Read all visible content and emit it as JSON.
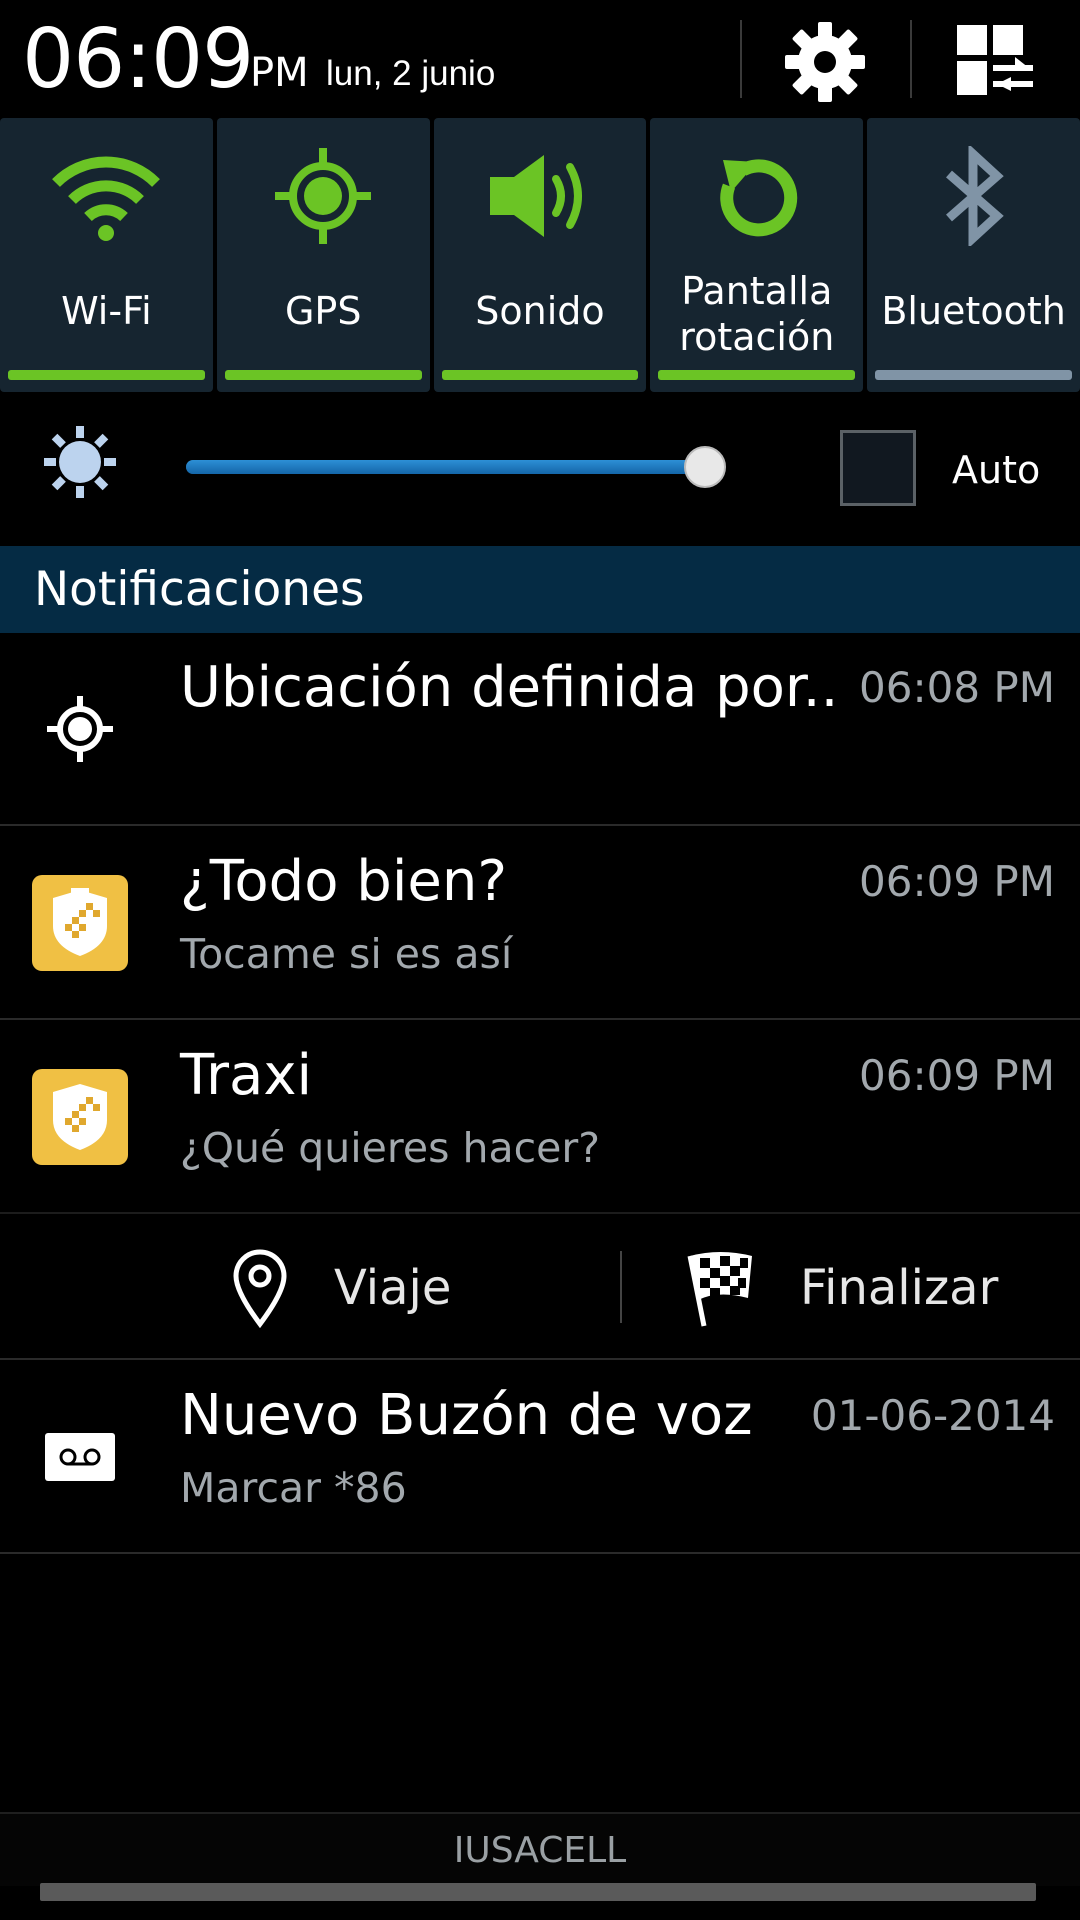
{
  "header": {
    "time": "06:09",
    "ampm": "PM",
    "date": "lun, 2 junio"
  },
  "toggles": [
    {
      "label": "Wi-Fi",
      "icon": "wifi-icon",
      "on": true
    },
    {
      "label": "GPS",
      "icon": "gps-icon",
      "on": true
    },
    {
      "label": "Sonido",
      "icon": "sound-icon",
      "on": true
    },
    {
      "label": "Pantalla rotación",
      "icon": "rotation-icon",
      "on": true
    },
    {
      "label": "Bluetooth",
      "icon": "bluetooth-icon",
      "on": false
    }
  ],
  "brightness": {
    "level": 0.965,
    "auto_label": "Auto",
    "auto_checked": false
  },
  "notifications_title": "Notificaciones",
  "notifications": [
    {
      "title": "Ubicación definida por..",
      "subtitle": "",
      "time": "06:08 PM",
      "icon": "location-target-icon"
    },
    {
      "title": "¿Todo bien?",
      "subtitle": "Tocame si es así",
      "time": "06:09 PM",
      "icon": "traxi-app-icon"
    },
    {
      "title": "Traxi",
      "subtitle": "¿Qué quieres hacer?",
      "time": "06:09 PM",
      "icon": "traxi-app-icon"
    },
    {
      "title": "Nuevo Buzón de voz",
      "subtitle": "Marcar *86",
      "time": "01-06-2014",
      "icon": "voicemail-icon"
    }
  ],
  "actions": [
    {
      "label": "Viaje",
      "icon": "map-pin-icon"
    },
    {
      "label": "Finalizar",
      "icon": "checkered-flag-icon"
    }
  ],
  "carrier": "IUSACELL",
  "colors": {
    "toggle_on": "#6bc425",
    "toggle_off": "#8094a6",
    "toggle_bg": "#162530",
    "notif_header_bg": "#052b44",
    "slider_fill": "#1f7ac2",
    "app_icon": "#f0c044"
  }
}
